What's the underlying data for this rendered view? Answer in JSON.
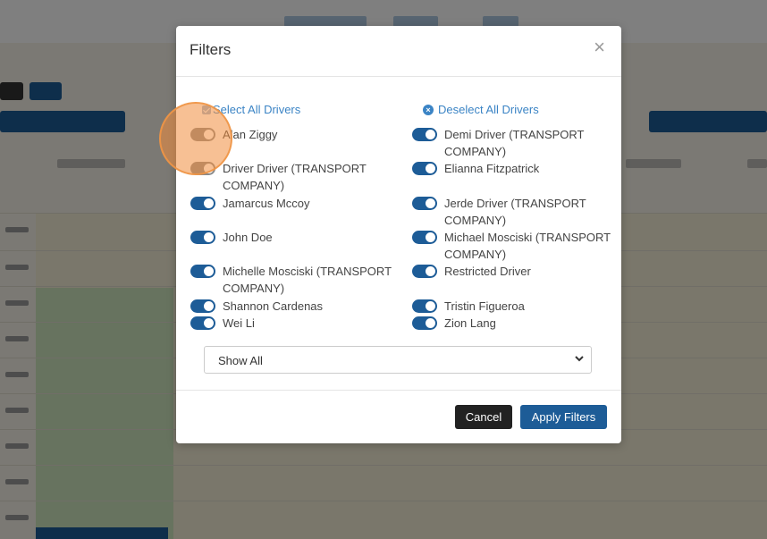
{
  "modal": {
    "title": "Filters",
    "close": "×",
    "select_all": "Select All Drivers",
    "deselect_all": "Deselect All Drivers",
    "drivers": [
      {
        "name": "Alan Ziggy",
        "enabled": false
      },
      {
        "name": "Demi Driver (TRANSPORT COMPANY)",
        "enabled": true
      },
      {
        "name": "Driver Driver (TRANSPORT COMPANY)",
        "enabled": false
      },
      {
        "name": "Elianna Fitzpatrick",
        "enabled": true
      },
      {
        "name": "Jamarcus Mccoy",
        "enabled": true
      },
      {
        "name": "Jerde Driver (TRANSPORT COMPANY)",
        "enabled": true
      },
      {
        "name": "John Doe",
        "enabled": true
      },
      {
        "name": "Michael Mosciski (TRANSPORT COMPANY)",
        "enabled": true
      },
      {
        "name": "Michelle Mosciski (TRANSPORT COMPANY)",
        "enabled": true
      },
      {
        "name": "Restricted Driver",
        "enabled": true
      },
      {
        "name": "Shannon Cardenas",
        "enabled": true
      },
      {
        "name": "Tristin Figueroa",
        "enabled": true
      },
      {
        "name": "Wei Li",
        "enabled": true
      },
      {
        "name": "Zion Lang",
        "enabled": true
      }
    ],
    "filter_select": {
      "value": "Show All"
    },
    "cancel_label": "Cancel",
    "apply_label": "Apply Filters"
  },
  "colors": {
    "primary": "#1d5c97",
    "link": "#3b84c5",
    "toggle_off": "#8a8a8a",
    "highlight": "#f08c3c"
  }
}
